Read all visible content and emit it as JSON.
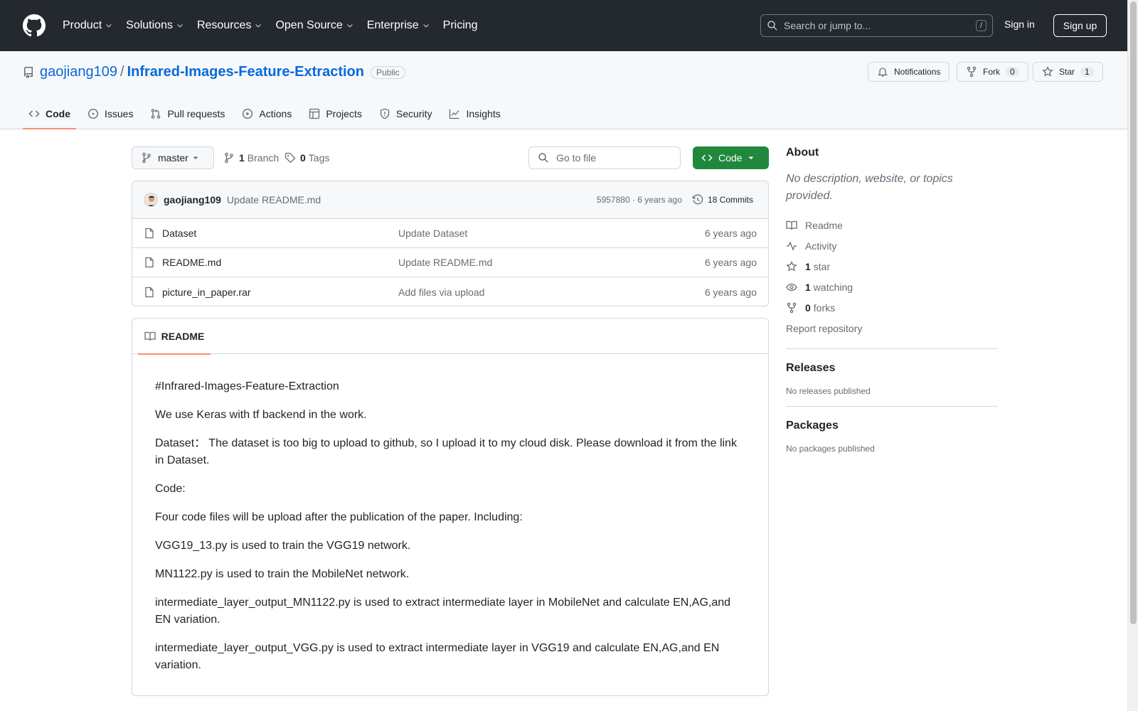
{
  "header": {
    "nav": [
      "Product",
      "Solutions",
      "Resources",
      "Open Source",
      "Enterprise",
      "Pricing"
    ],
    "search_placeholder": "Search or jump to...",
    "search_shortcut": "/",
    "sign_in": "Sign in",
    "sign_up": "Sign up"
  },
  "repo": {
    "owner": "gaojiang109",
    "separator": "/",
    "name": "Infrared-Images-Feature-Extraction",
    "visibility": "Public",
    "notifications_label": "Notifications",
    "fork_label": "Fork",
    "fork_count": "0",
    "star_label": "Star",
    "star_count": "1"
  },
  "tabs": [
    "Code",
    "Issues",
    "Pull requests",
    "Actions",
    "Projects",
    "Security",
    "Insights"
  ],
  "toolbar": {
    "branch": "master",
    "branch_count": "1",
    "branch_label": "Branch",
    "tag_count": "0",
    "tag_label": "Tags",
    "goto_placeholder": "Go to file",
    "code_button": "Code"
  },
  "latest_commit": {
    "author": "gaojiang109",
    "message": "Update README.md",
    "meta": "5957880 · 6 years ago",
    "commits": "18 Commits"
  },
  "files": [
    {
      "name": "Dataset",
      "commit": "Update Dataset",
      "age": "6 years ago"
    },
    {
      "name": "README.md",
      "commit": "Update README.md",
      "age": "6 years ago"
    },
    {
      "name": "picture_in_paper.rar",
      "commit": "Add files via upload",
      "age": "6 years ago"
    }
  ],
  "readme": {
    "tab_label": "README",
    "paragraphs": [
      "#Infrared-Images-Feature-Extraction",
      "We use Keras with tf backend in the work.",
      "Dataset：  The dataset is too big to upload to github, so I upload it to my cloud disk. Please download it from the link in Dataset.",
      "Code:",
      "Four code files will be upload after the publication of the paper. Including:",
      "VGG19_13.py is used to train the VGG19 network.",
      "MN1122.py is used to train the MobileNet network.",
      "intermediate_layer_output_MN1122.py is used to extract intermediate layer in MobileNet and calculate EN,AG,and EN variation.",
      "intermediate_layer_output_VGG.py is used to extract intermediate layer in VGG19 and calculate EN,AG,and EN variation."
    ]
  },
  "sidebar": {
    "about_title": "About",
    "about_desc": "No description, website, or topics provided.",
    "readme": "Readme",
    "activity": "Activity",
    "stars_count": "1",
    "stars_label": "star",
    "watching_count": "1",
    "watching_label": "watching",
    "forks_count": "0",
    "forks_label": "forks",
    "report": "Report repository",
    "releases_title": "Releases",
    "releases_empty": "No releases published",
    "packages_title": "Packages",
    "packages_empty": "No packages published"
  }
}
